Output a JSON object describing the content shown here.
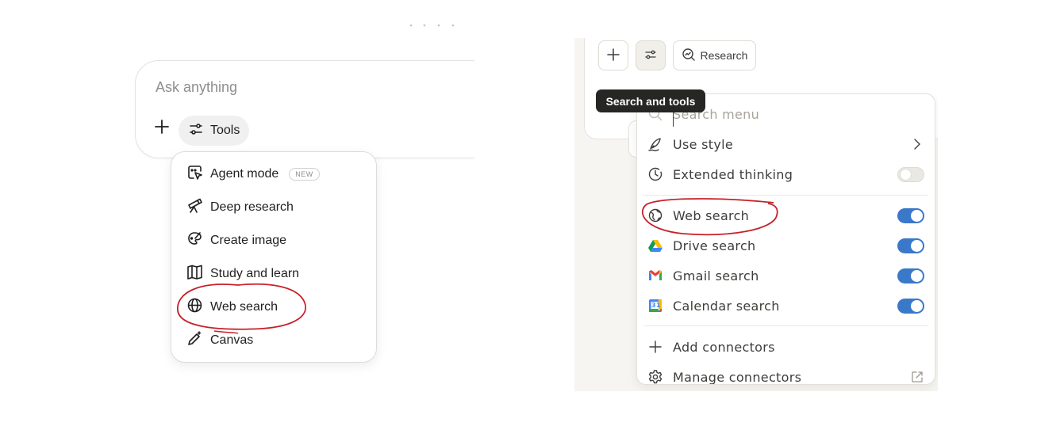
{
  "left": {
    "composer": {
      "placeholder": "Ask anything"
    },
    "tools_button": {
      "label": "Tools",
      "icon": "sliders-icon"
    },
    "menu": {
      "items": [
        {
          "label": "Agent mode",
          "icon": "agent-cursor-icon",
          "badge": "NEW"
        },
        {
          "label": "Deep research",
          "icon": "telescope-icon"
        },
        {
          "label": "Create image",
          "icon": "palette-icon"
        },
        {
          "label": "Study and learn",
          "icon": "book-icon"
        },
        {
          "label": "Web search",
          "icon": "globe-icon"
        },
        {
          "label": "Canvas",
          "icon": "pencil-sparkle-icon"
        }
      ]
    }
  },
  "right": {
    "toolbar": {
      "add": "plus-icon",
      "tools": "sliders-icon",
      "research_label": "Research"
    },
    "tooltip": "Search and tools",
    "menu": {
      "search_placeholder": "Search menu",
      "items": [
        {
          "label": "Use style",
          "icon": "pen-style-icon",
          "control": "chevron"
        },
        {
          "label": "Extended thinking",
          "icon": "clock-icon",
          "control": "toggle",
          "on": false
        },
        {
          "label": "Web search",
          "icon": "globe-icon",
          "control": "toggle",
          "on": true
        },
        {
          "label": "Drive search",
          "icon": "google-drive-icon",
          "control": "toggle",
          "on": true
        },
        {
          "label": "Gmail search",
          "icon": "gmail-icon",
          "control": "toggle",
          "on": true
        },
        {
          "label": "Calendar search",
          "icon": "google-calendar-icon",
          "control": "toggle",
          "on": true
        },
        {
          "label": "Add connectors",
          "icon": "plus-icon"
        },
        {
          "label": "Manage connectors",
          "icon": "gear-icon",
          "control": "external-link"
        }
      ],
      "calendar_day": "31"
    }
  },
  "colors": {
    "annotation": "#c8202a",
    "toggle_on": "#3a78c9"
  }
}
